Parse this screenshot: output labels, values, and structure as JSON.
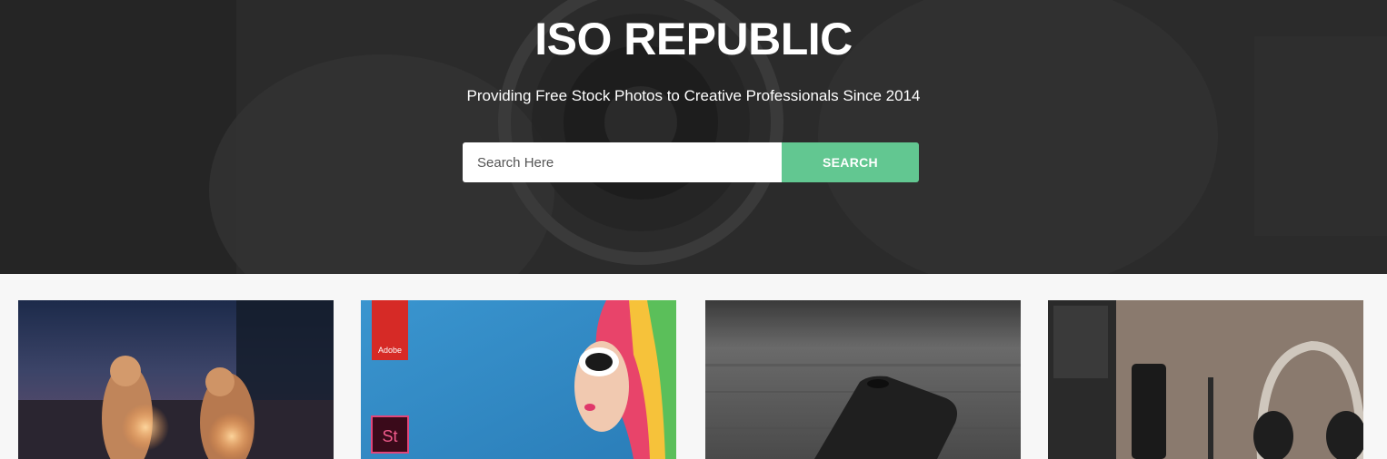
{
  "hero": {
    "title": "ISO REPUBLIC",
    "tagline": "Providing Free Stock Photos to Creative Professionals Since 2014",
    "background_image": "camera-lens-photo"
  },
  "search": {
    "placeholder": "Search Here",
    "button_label": "SEARCH",
    "button_color": "#62c791"
  },
  "photos": [
    {
      "subject": "two-women-sparklers-night"
    },
    {
      "subject": "adobe-stock-rainbow-hair-sunglasses",
      "badge_top": "Adobe",
      "badge_bottom": "St"
    },
    {
      "subject": "black-iphone-wooden-table"
    },
    {
      "subject": "desk-phone-pen-headphones"
    }
  ]
}
